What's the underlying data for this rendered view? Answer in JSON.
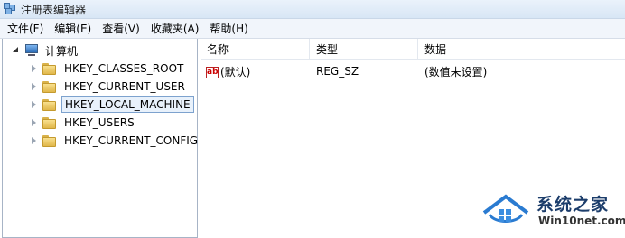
{
  "window": {
    "title": "注册表编辑器",
    "icon": "registry-editor-icon"
  },
  "menu": [
    "文件(F)",
    "编辑(E)",
    "查看(V)",
    "收藏夹(A)",
    "帮助(H)"
  ],
  "tree": {
    "root_label": "计算机",
    "items": [
      {
        "label": "HKEY_CLASSES_ROOT"
      },
      {
        "label": "HKEY_CURRENT_USER"
      },
      {
        "label": "HKEY_LOCAL_MACHINE",
        "selected": true
      },
      {
        "label": "HKEY_USERS"
      },
      {
        "label": "HKEY_CURRENT_CONFIG"
      }
    ]
  },
  "list": {
    "columns": [
      "名称",
      "类型",
      "数据"
    ],
    "rows": [
      {
        "name": "(默认)",
        "type": "REG_SZ",
        "data": "(数值未设置)"
      }
    ]
  },
  "watermark": {
    "title": "系统之家",
    "subtitle": "Win10net.com"
  }
}
